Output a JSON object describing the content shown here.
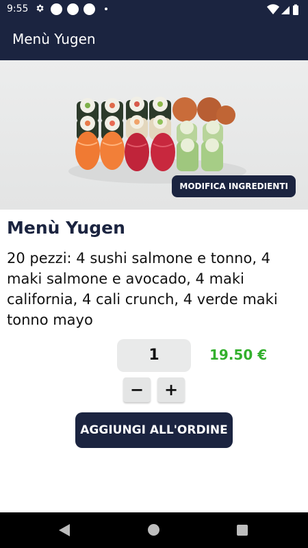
{
  "status_bar": {
    "time": "9:55",
    "icons": [
      "gear-icon",
      "notification-dot",
      "notification-dot",
      "notification-dot",
      "wifi-icon",
      "signal-icon",
      "battery-icon"
    ]
  },
  "app_bar": {
    "title": "Menù Yugen"
  },
  "hero": {
    "image": "sushi-platter-image",
    "edit_ingredients_label": "MODIFICA INGREDIENTI"
  },
  "product": {
    "title": "Menù Yugen",
    "description": "20 pezzi: 4 sushi salmone e tonno, 4 maki salmone e avocado, 4 maki california, 4 cali crunch, 4 verde maki tonno mayo",
    "quantity": "1",
    "price": "19.50 €",
    "decrement_label": "−",
    "increment_label": "+",
    "add_to_order_label": "AGGIUNGI ALL'ORDINE"
  },
  "colors": {
    "primary": "#1b2440",
    "price_green": "#33b02d",
    "quantity_bg": "#e9eaea"
  },
  "nav_bar": {
    "icons": [
      "back-icon",
      "home-icon",
      "recents-icon"
    ]
  }
}
